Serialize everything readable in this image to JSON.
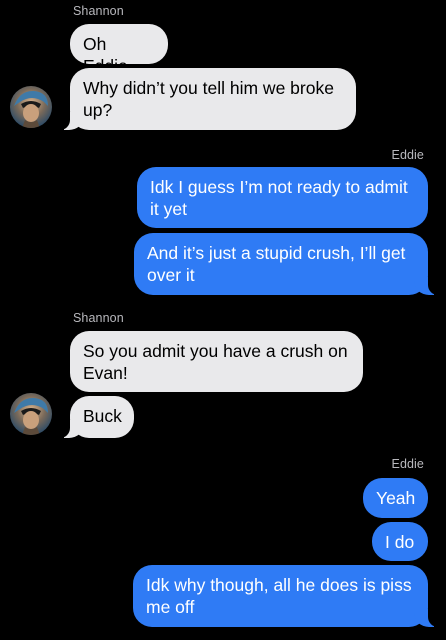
{
  "thread": {
    "groups": [
      {
        "sender": "Shannon",
        "direction": "incoming",
        "messages": [
          "Oh Eddie",
          "Why didn’t you tell him we broke up?"
        ]
      },
      {
        "sender": "Eddie",
        "direction": "outgoing",
        "messages": [
          "Idk I guess I’m not ready to admit it yet",
          "And it’s just a stupid crush, I’ll get over it"
        ]
      },
      {
        "sender": "Shannon",
        "direction": "incoming",
        "messages": [
          "So you admit you have a crush on Evan!",
          "Buck"
        ]
      },
      {
        "sender": "Eddie",
        "direction": "outgoing",
        "messages": [
          "Yeah",
          "I do",
          "Idk why though, all he does is piss me off"
        ]
      }
    ]
  },
  "colors": {
    "background": "#000000",
    "incoming_bubble": "#e9e9eb",
    "outgoing_bubble": "#2f7bf5",
    "sender_label": "#b8b8bd"
  },
  "icons": {
    "contact_avatar": "avatar-photo-icon"
  }
}
